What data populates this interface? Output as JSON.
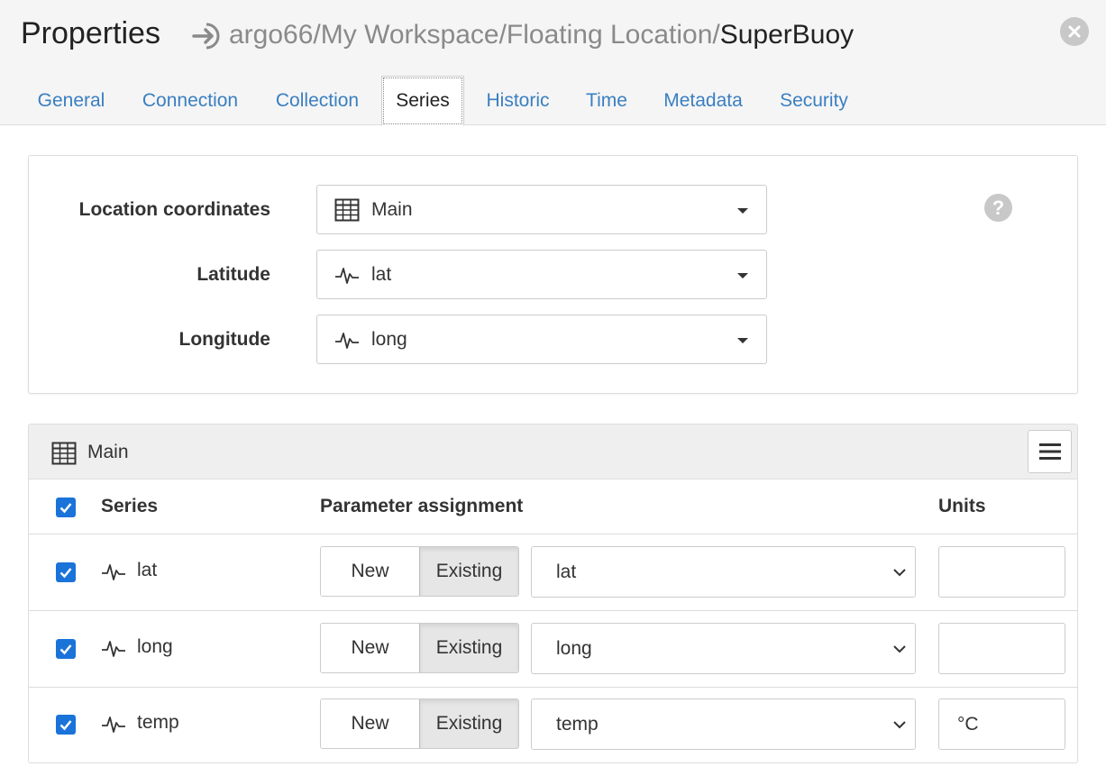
{
  "header": {
    "title": "Properties",
    "breadcrumb_path": "argo66/My Workspace/Floating Location/",
    "breadcrumb_current": "SuperBuoy"
  },
  "tabs": [
    {
      "label": "General",
      "active": false
    },
    {
      "label": "Connection",
      "active": false
    },
    {
      "label": "Collection",
      "active": false
    },
    {
      "label": "Series",
      "active": true
    },
    {
      "label": "Historic",
      "active": false
    },
    {
      "label": "Time",
      "active": false
    },
    {
      "label": "Metadata",
      "active": false
    },
    {
      "label": "Security",
      "active": false
    }
  ],
  "location": {
    "coordinates_label": "Location coordinates",
    "coordinates_value": "Main",
    "latitude_label": "Latitude",
    "latitude_value": "lat",
    "longitude_label": "Longitude",
    "longitude_value": "long",
    "help_glyph": "?"
  },
  "table": {
    "title": "Main",
    "col_series": "Series",
    "col_param": "Parameter assignment",
    "col_units": "Units",
    "new_label": "New",
    "existing_label": "Existing",
    "rows": [
      {
        "series": "lat",
        "checked": true,
        "param": "lat",
        "units": ""
      },
      {
        "series": "long",
        "checked": true,
        "param": "long",
        "units": ""
      },
      {
        "series": "temp",
        "checked": true,
        "param": "temp",
        "units": "°C"
      }
    ]
  },
  "colors": {
    "link": "#3a7fc1",
    "checkbox": "#1a73d9",
    "header_bg": "#f5f5f5"
  },
  "icons": {
    "breadcrumb": "arrow-right-circle-icon",
    "close": "close-icon",
    "table": "table-grid-icon",
    "series": "waveform-icon",
    "menu": "hamburger-menu-icon",
    "help": "help-icon"
  }
}
